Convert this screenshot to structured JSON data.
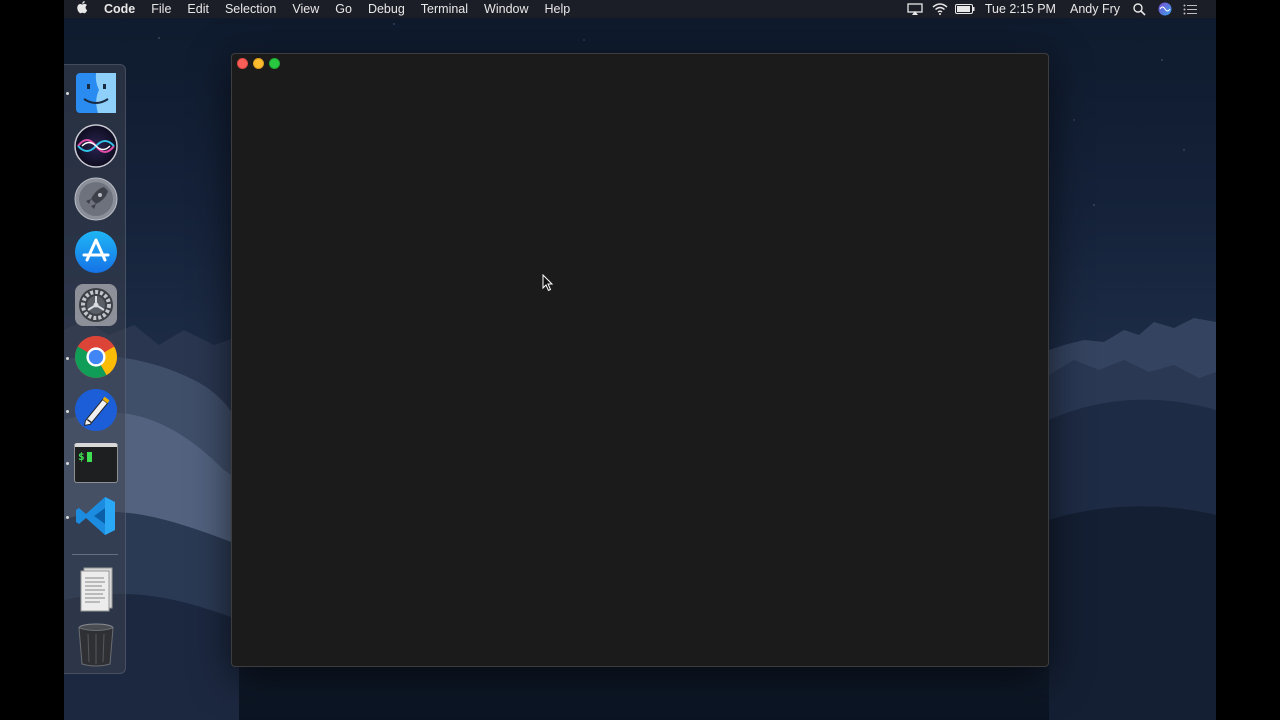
{
  "menubar": {
    "apple_icon": "apple-logo-icon",
    "app_name": "Code",
    "menus": [
      "File",
      "Edit",
      "Selection",
      "View",
      "Go",
      "Debug",
      "Terminal",
      "Window",
      "Help"
    ],
    "status_icons": [
      "airplay-icon",
      "wifi-icon",
      "battery-icon"
    ],
    "clock": "Tue 2:15 PM",
    "user": "Andy Fry",
    "right_icons": [
      "spotlight-icon",
      "siri-icon",
      "notification-center-icon"
    ]
  },
  "dock": {
    "apps": [
      {
        "name": "Finder",
        "icon": "finder-icon",
        "running": true
      },
      {
        "name": "Siri",
        "icon": "siri-icon",
        "running": false
      },
      {
        "name": "Launchpad",
        "icon": "launchpad-icon",
        "running": false
      },
      {
        "name": "App Store",
        "icon": "app-store-icon",
        "running": false
      },
      {
        "name": "System Preferences",
        "icon": "system-preferences-icon",
        "running": false
      },
      {
        "name": "Google Chrome",
        "icon": "chrome-icon",
        "running": true
      },
      {
        "name": "Sketchbook",
        "icon": "pen-icon",
        "running": true
      },
      {
        "name": "Terminal",
        "icon": "terminal-icon",
        "running": true
      },
      {
        "name": "Visual Studio Code",
        "icon": "vscode-icon",
        "running": true
      }
    ],
    "others": [
      {
        "name": "Documents",
        "icon": "document-stack-icon"
      },
      {
        "name": "Trash",
        "icon": "trash-icon"
      }
    ],
    "terminal_glyph": "$"
  },
  "window": {
    "background": "#1b1b1b",
    "traffic_lights": [
      "close",
      "minimize",
      "maximize"
    ]
  }
}
